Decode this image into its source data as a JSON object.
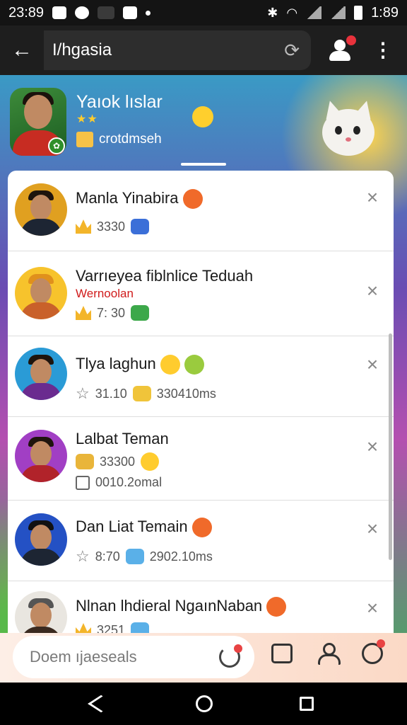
{
  "status_bar": {
    "time_left": "23:89",
    "time_right": "1:89"
  },
  "app_bar": {
    "title": "I/hgasia",
    "icons": [
      "back-arrow-icon",
      "refresh-icon",
      "add-person-icon",
      "more-vert-icon"
    ]
  },
  "profile": {
    "name": "Yaıok lıslar",
    "stars": "★★",
    "subtitle": "crotdmseh"
  },
  "friends": [
    {
      "name": "Manla Yinabira",
      "sub_red": "",
      "meta_icon": "crown-icon",
      "meta": "3330",
      "extra": "",
      "avatar_bg": "#e0a020"
    },
    {
      "name": "Varrıeyea fiblnlice Teduah",
      "sub_red": "Wernoolan",
      "meta_icon": "crown-icon",
      "meta": "7: 30",
      "extra": "",
      "avatar_bg": "#f7c32c"
    },
    {
      "name": "Tlya laghun",
      "sub_red": "",
      "meta_icon": "star-outline-icon",
      "meta": "31.10",
      "extra": "330410ms",
      "avatar_bg": "#2a9bd6"
    },
    {
      "name": "Lalbat Teman",
      "sub_red": "",
      "meta_icon": "sticker-icon",
      "meta": "33300",
      "extra": "0010.2omal",
      "avatar_bg": "#a13fc4"
    },
    {
      "name": "Dan Liat Temain",
      "sub_red": "",
      "meta_icon": "star-outline-icon",
      "meta": "8:70",
      "extra": "2902.10ms",
      "avatar_bg": "#2451c4"
    },
    {
      "name": "Nlnan lhdieral NgaınNaban",
      "sub_red": "",
      "meta_icon": "crown-icon",
      "meta": "3251",
      "extra": "",
      "avatar_bg": "#e9e6e0"
    }
  ],
  "input_bar": {
    "placeholder": "Doem ıjaeseals"
  },
  "colors": {
    "accent_red": "#e84343",
    "crown_gold": "#f3b52a",
    "sub_red": "#d01b1b"
  }
}
